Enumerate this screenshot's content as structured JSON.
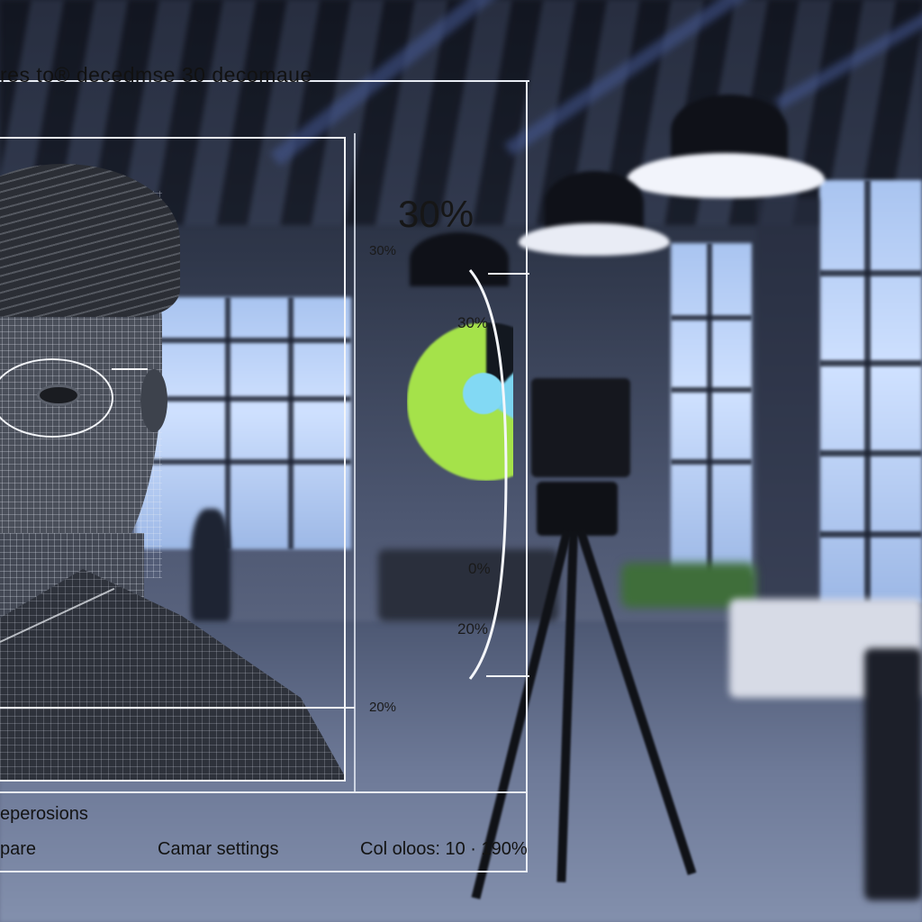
{
  "overlay": {
    "title": "res to® decedmse 30 decomaue"
  },
  "metrics": {
    "main_percent": "30%",
    "labels": {
      "top_left": "30%",
      "pie_label": "30%",
      "mid": "0%",
      "lower": "20%",
      "bottom_left": "20%"
    }
  },
  "bottom_bar": {
    "heading": "eperosions",
    "item_left": "pare",
    "item_center": "Camar settings",
    "item_right": "Col oloos: 10 · 190%"
  },
  "colors": {
    "pie_green": "#a5e24a",
    "pie_blue": "#7bd4f0",
    "overlay_line": "#e8ecf4"
  },
  "icons": {
    "pie": "pie-chart-icon",
    "bracket": "range-bracket-icon"
  }
}
